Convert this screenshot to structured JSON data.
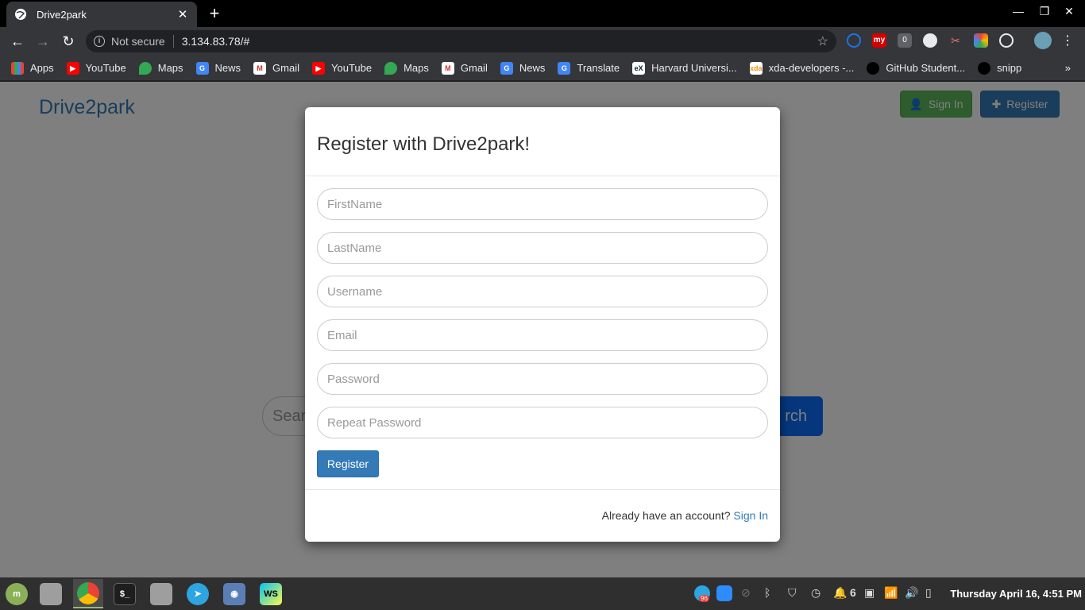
{
  "browser": {
    "tab_title": "Drive2park",
    "security_label": "Not secure",
    "url": "3.134.83.78/#",
    "bookmarks": [
      {
        "label": "Apps",
        "icon": "apps-grid-icon"
      },
      {
        "label": "YouTube",
        "icon": "youtube-icon"
      },
      {
        "label": "Maps",
        "icon": "maps-icon"
      },
      {
        "label": "News",
        "icon": "news-icon"
      },
      {
        "label": "Gmail",
        "icon": "gmail-icon"
      },
      {
        "label": "YouTube",
        "icon": "youtube-icon"
      },
      {
        "label": "Maps",
        "icon": "maps-icon"
      },
      {
        "label": "Gmail",
        "icon": "gmail-icon"
      },
      {
        "label": "News",
        "icon": "news-icon"
      },
      {
        "label": "Translate",
        "icon": "translate-icon"
      },
      {
        "label": "Harvard Universi...",
        "icon": "edx-icon"
      },
      {
        "label": "xda-developers -...",
        "icon": "xda-icon"
      },
      {
        "label": "GitHub Student...",
        "icon": "github-icon"
      },
      {
        "label": "snipp",
        "icon": "github-icon"
      }
    ],
    "extension_badge": "0",
    "more": "»"
  },
  "page": {
    "brand": "Drive2park",
    "signin_label": "Sign In",
    "register_label": "Register",
    "search_placeholder": "Sear",
    "search_button": "rch"
  },
  "modal": {
    "title": "Register with Drive2park!",
    "fields": [
      {
        "placeholder": "FirstName"
      },
      {
        "placeholder": "LastName"
      },
      {
        "placeholder": "Username"
      },
      {
        "placeholder": "Email"
      },
      {
        "placeholder": "Password"
      },
      {
        "placeholder": "Repeat Password"
      }
    ],
    "submit_label": "Register",
    "footer_text": "Already have an account?",
    "footer_link": "Sign In"
  },
  "taskbar": {
    "notification_count": "6",
    "telegram_badge": "96",
    "clock": "Thursday April 16, 4:51 PM"
  },
  "colors": {
    "primary": "#337ab7",
    "success": "#5cb85c",
    "search": "#0d6efd"
  }
}
